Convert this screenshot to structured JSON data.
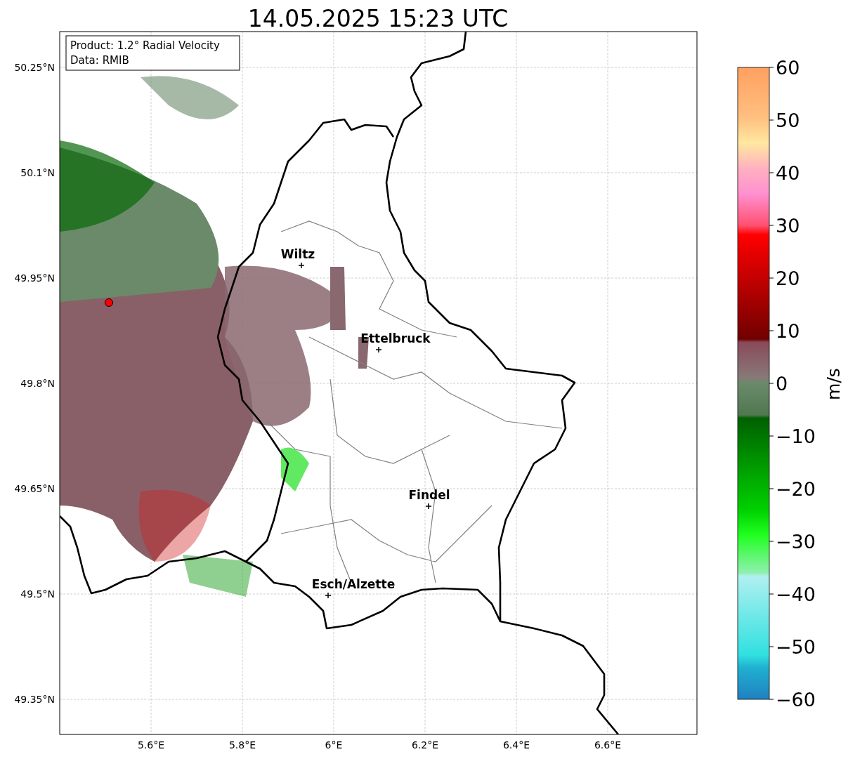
{
  "title": "14.05.2025 15:23 UTC",
  "info_box": {
    "lines": [
      "Product: 1.2° Radial Velocity",
      "Data: RMIB"
    ]
  },
  "map": {
    "lat_ticks": [
      "50.25°N",
      "50.1°N",
      "49.95°N",
      "49.8°N",
      "49.65°N",
      "49.5°N",
      "49.35°N"
    ],
    "lon_ticks": [
      "5.6°E",
      "5.8°E",
      "6°E",
      "6.2°E",
      "6.4°E",
      "6.6°E"
    ],
    "cities": [
      {
        "name": "Wiltz"
      },
      {
        "name": "Ettelbruck"
      },
      {
        "name": "Findel"
      },
      {
        "name": "Esch/Alzette"
      }
    ]
  },
  "colorbar": {
    "label": "m/s",
    "ticks": [
      "60",
      "50",
      "40",
      "30",
      "20",
      "10",
      "0",
      "−10",
      "−20",
      "−30",
      "−40",
      "−50",
      "−60"
    ]
  }
}
